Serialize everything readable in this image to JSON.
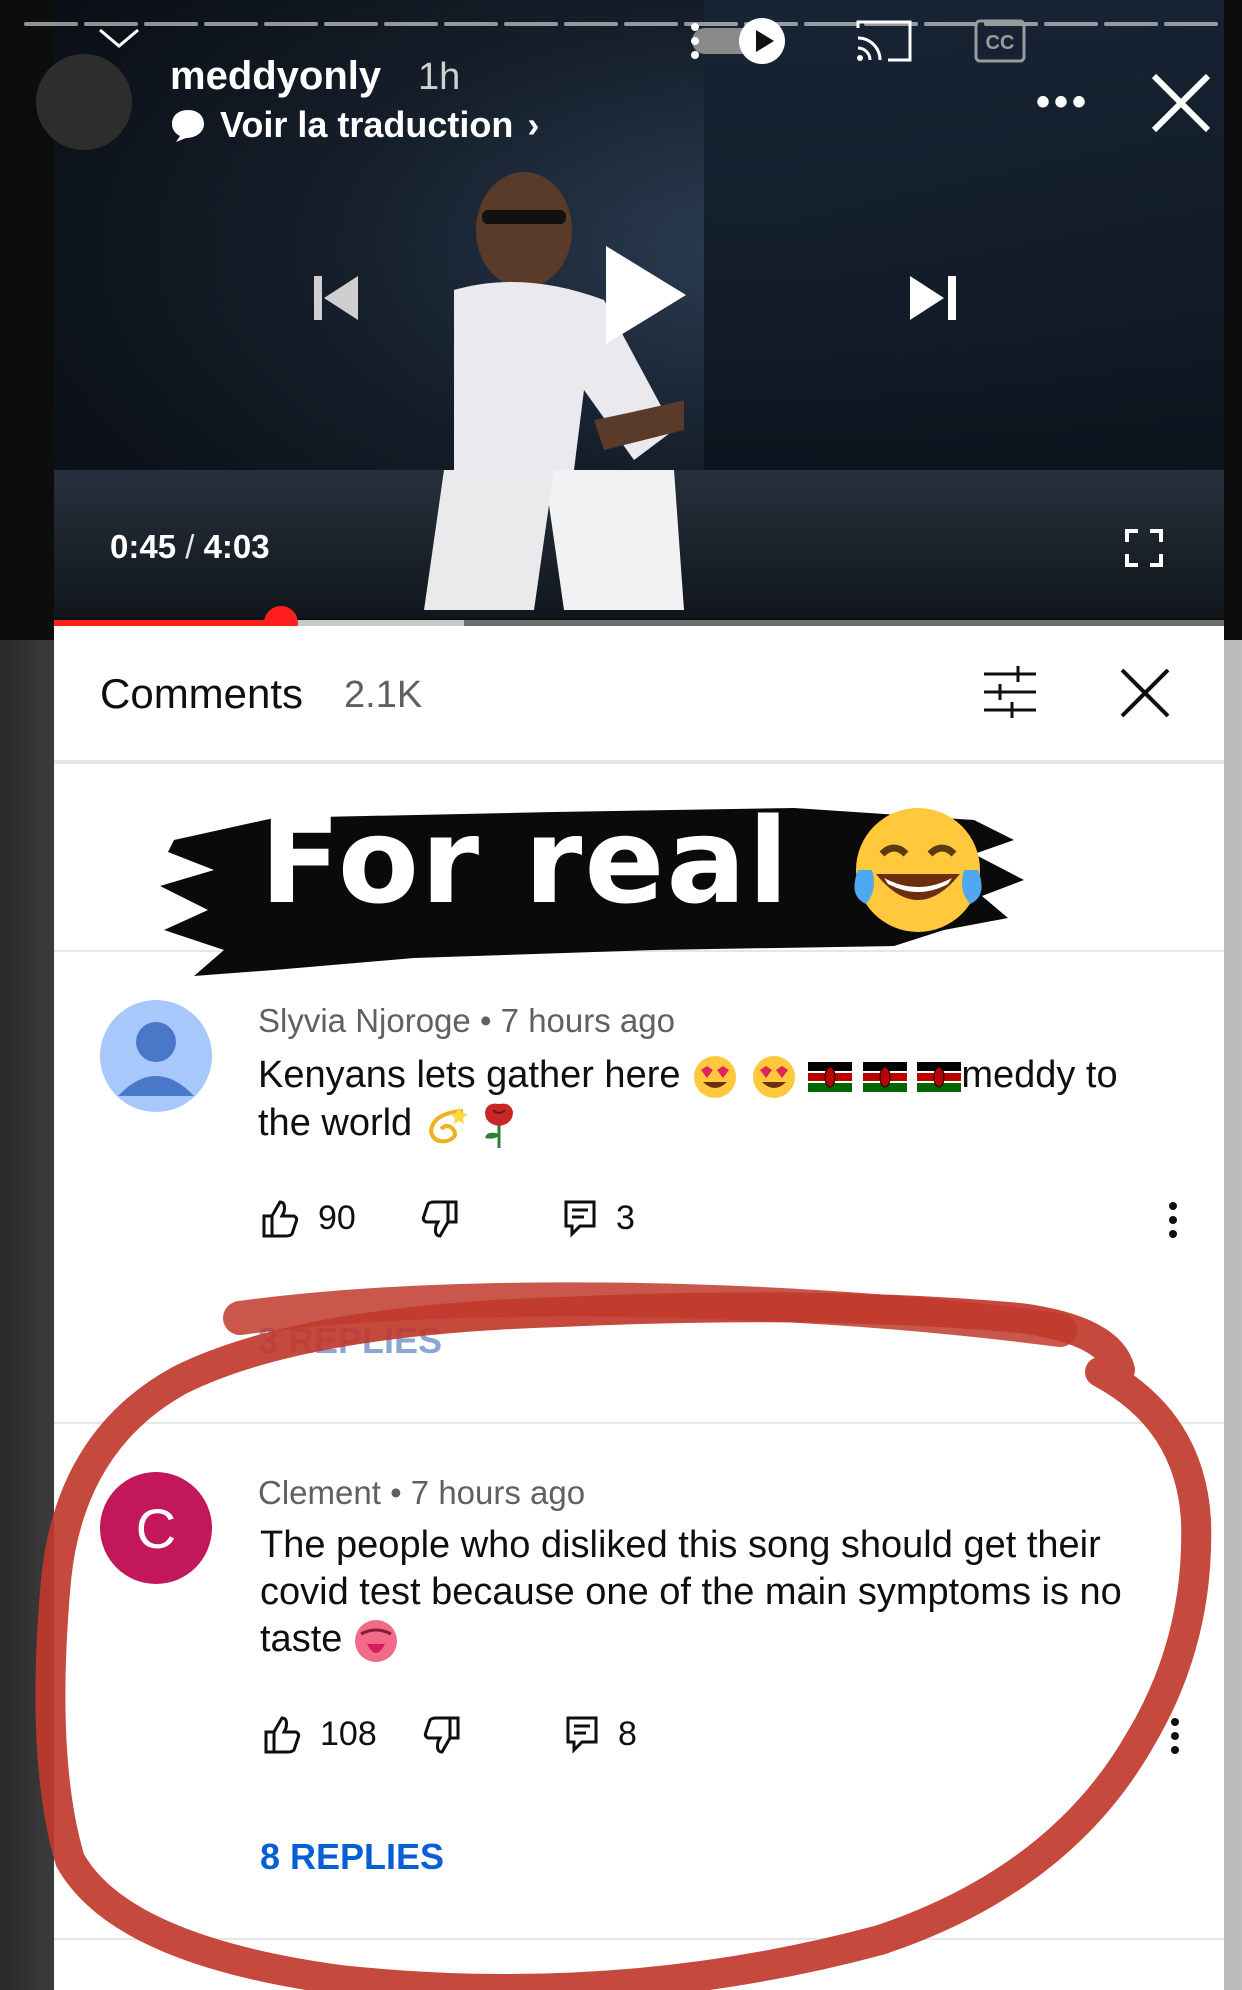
{
  "story": {
    "username": "meddyonly",
    "posted_ago": "1h",
    "translate_label": "Voir la traduction",
    "more_label": "•••"
  },
  "video": {
    "current_time": "0:45",
    "separator": "/",
    "duration": "4:03",
    "progress_fraction": 0.185
  },
  "comments_panel": {
    "title": "Comments",
    "count": "2.1K"
  },
  "sticker": {
    "text": "For real"
  },
  "comments": [
    {
      "author": "Slyvia Njoroge",
      "ago": "7 hours ago",
      "text_line1": "Kenyans lets gather here",
      "text_after_flags": "meddy to",
      "text_line2": "the world",
      "likes": "90",
      "reply_count": "3",
      "replies_label": "3 REPLIES"
    },
    {
      "author": "Clement",
      "avatar_letter": "C",
      "ago": "7 hours ago",
      "text": "The people who disliked this song should get their covid test because one of the main symptoms is no taste",
      "likes": "108",
      "reply_count": "8",
      "replies_label": "8 REPLIES"
    }
  ],
  "colors": {
    "progress_red": "#ff1e1e",
    "replies_blue": "#065fd4",
    "clement_avatar": "#c2185b",
    "default_avatar": "#a8c7fa",
    "ink_circle": "#c0392b"
  },
  "icons": {
    "play": "play-icon",
    "prev": "previous-icon",
    "next": "next-icon",
    "fullscreen": "fullscreen-icon",
    "cast": "cast-icon",
    "captions": "captions-icon",
    "sort": "sort-icon",
    "close": "close-icon",
    "like": "thumbs-up-icon",
    "dislike": "thumbs-down-icon",
    "reply": "reply-icon"
  }
}
